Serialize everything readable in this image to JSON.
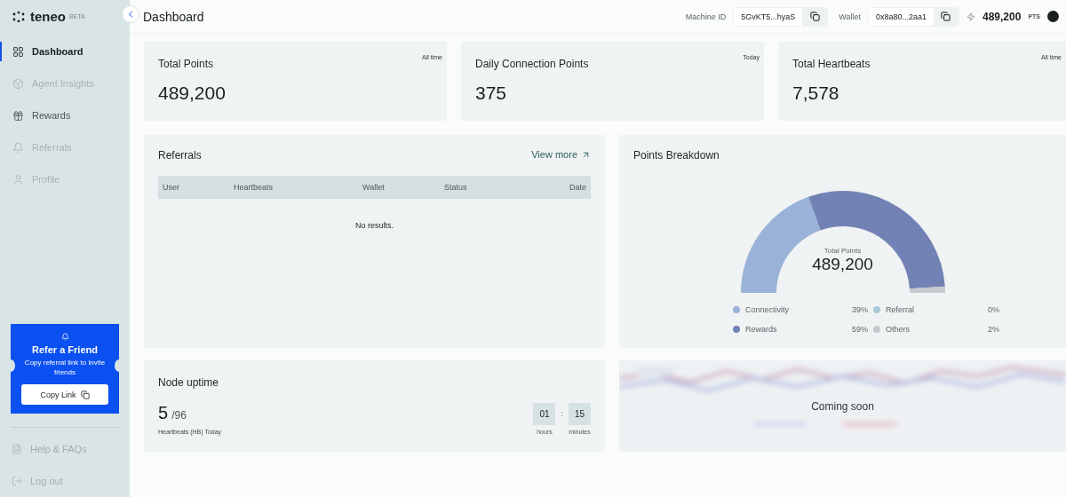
{
  "brand": {
    "name": "teneo",
    "badge": "BETA"
  },
  "sidebar": {
    "items": [
      {
        "label": "Dashboard",
        "selected": true,
        "disabled": false
      },
      {
        "label": "Agent Insights",
        "selected": false,
        "disabled": true
      },
      {
        "label": "Rewards",
        "selected": false,
        "disabled": false
      },
      {
        "label": "Referrals",
        "selected": false,
        "disabled": true
      },
      {
        "label": "Profile",
        "selected": false,
        "disabled": true
      }
    ],
    "refer_card": {
      "title": "Refer a Friend",
      "text": "Copy referral link to invite friends",
      "button": "Copy Link"
    },
    "footer_items": [
      {
        "label": "Help & FAQs"
      },
      {
        "label": "Log out"
      }
    ]
  },
  "header": {
    "title": "Dashboard",
    "fields": [
      {
        "label": "Machine ID",
        "value": "5GvKT5...hyaS"
      },
      {
        "label": "Wallet",
        "value": "0x8a80...2aa1"
      }
    ],
    "points": "489,200",
    "points_unit": "PTS"
  },
  "stats": [
    {
      "title": "Total Points",
      "period": "All time",
      "value": "489,200"
    },
    {
      "title": "Daily Connection Points",
      "period": "Today",
      "value": "375"
    },
    {
      "title": "Total Heartbeats",
      "period": "All time",
      "value": "7,578"
    }
  ],
  "referrals": {
    "title": "Referrals",
    "link": "View more",
    "columns": [
      "User",
      "Heartbeats",
      "Wallet",
      "Status",
      "Date"
    ],
    "empty": "No results."
  },
  "breakdown": {
    "title": "Points Breakdown",
    "center_label": "Total Points",
    "center_value": "489,200",
    "legend": [
      {
        "percent": "39%",
        "color": "#9ab2d8"
      },
      {
        "percent": "0%",
        "color": "#a9cbd9"
      },
      {
        "percent": "59%",
        "color": "#7382b4"
      },
      {
        "percent": "2%",
        "color": "#c4cbcd"
      }
    ],
    "chart_data": {
      "type": "donut",
      "categories": [
        "Connectivity",
        "Referral",
        "Rewards",
        "Others"
      ],
      "values": [
        39,
        0,
        59,
        2
      ]
    }
  },
  "uptime": {
    "title": "Node uptime",
    "count": "5",
    "total": "/96",
    "caption": "Heartbeats (HB) Today",
    "timer": [
      {
        "value": "01",
        "unit": "hours"
      },
      {
        "value": "15",
        "unit": "minutes"
      }
    ],
    "separator": ":"
  },
  "coming_soon": {
    "text": "Coming soon"
  }
}
